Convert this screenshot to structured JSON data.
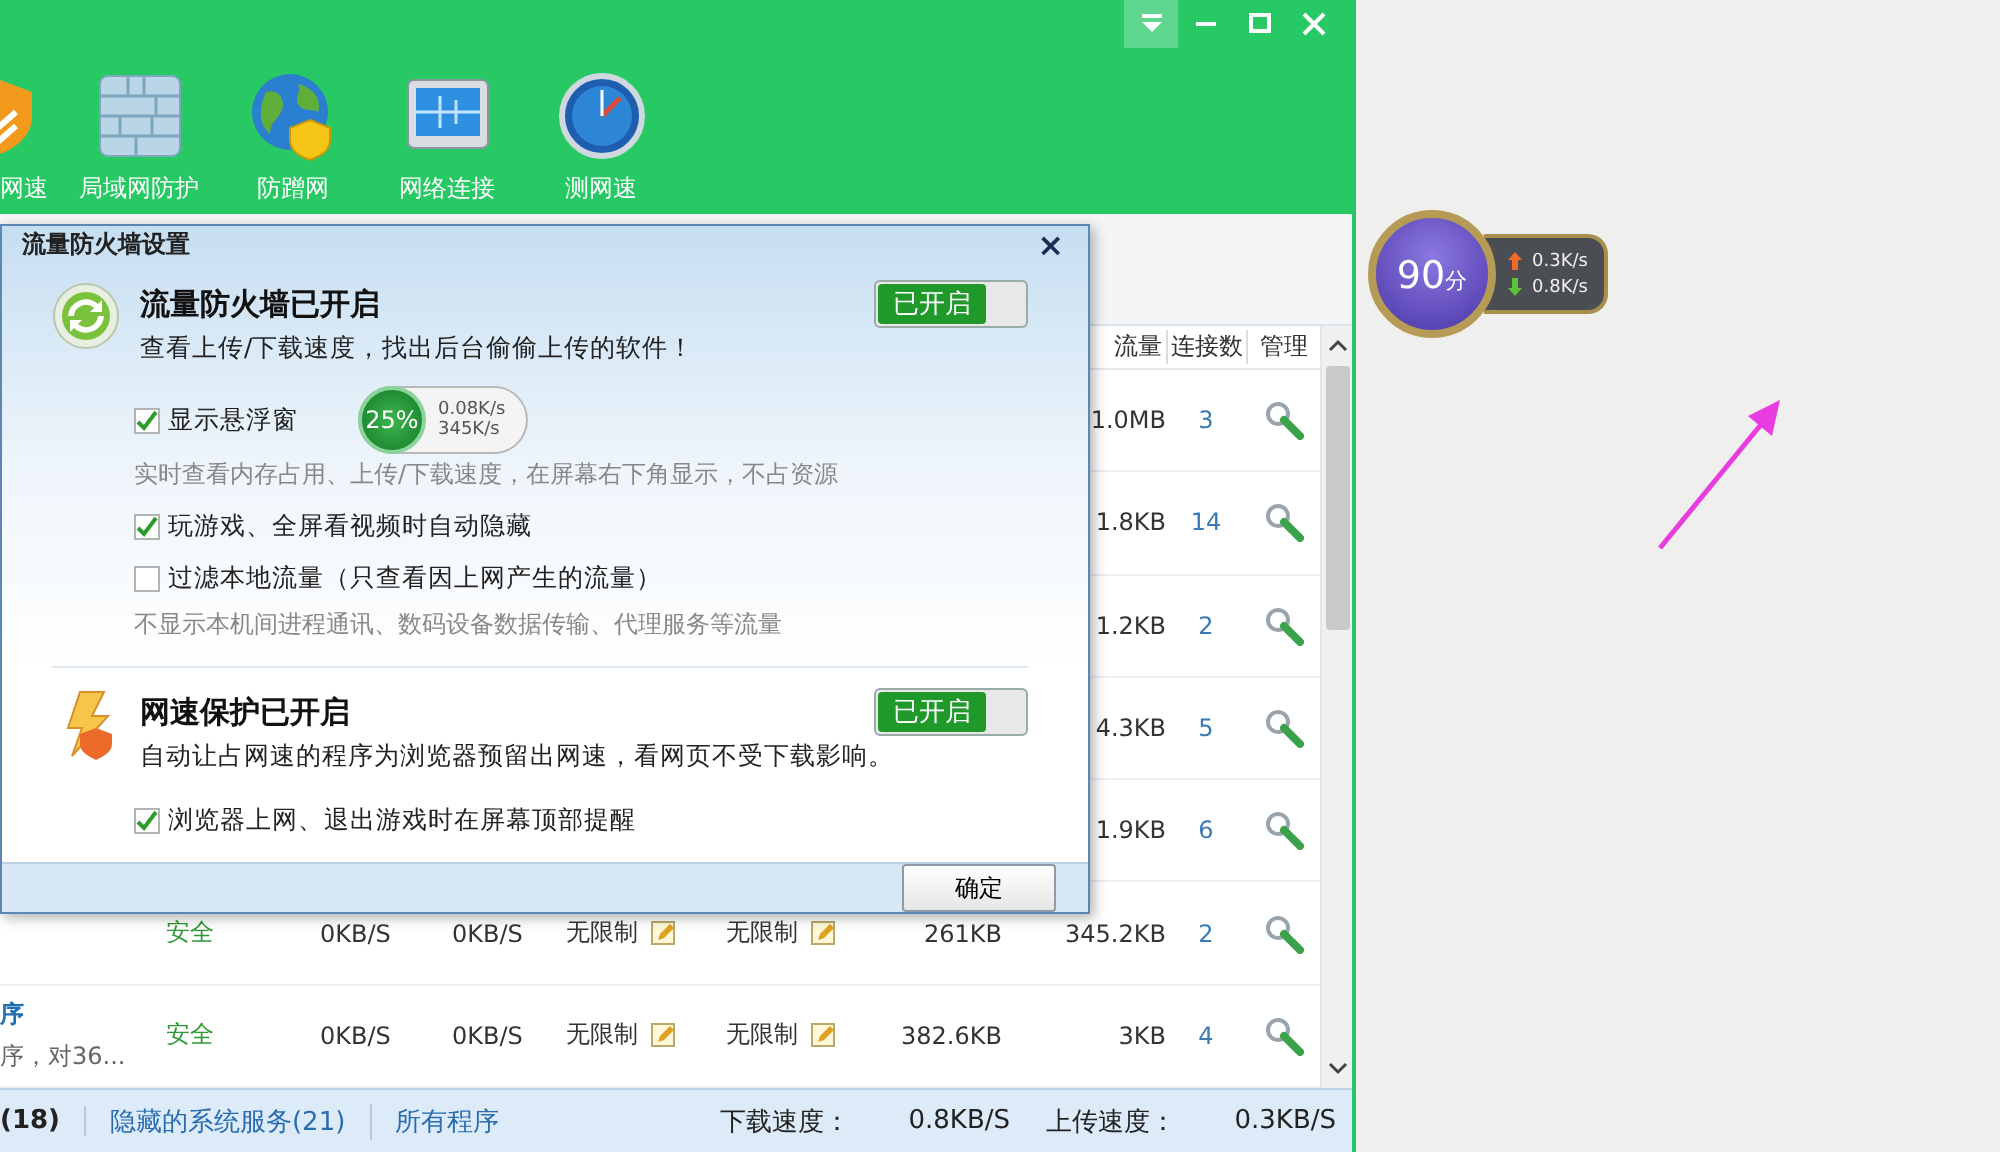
{
  "app": {
    "window_controls": [
      {
        "kind": "dropdown",
        "highlighted": true
      },
      {
        "kind": "minimize",
        "highlighted": false
      },
      {
        "kind": "maximize",
        "highlighted": false
      },
      {
        "kind": "close",
        "highlighted": false
      }
    ],
    "toolbar": [
      {
        "label": "网速",
        "kind": "shield"
      },
      {
        "label": "局域网防护",
        "kind": "wall"
      },
      {
        "label": "防蹭网",
        "kind": "globe"
      },
      {
        "label": "网络连接",
        "kind": "monitor"
      },
      {
        "label": "测网速",
        "kind": "gauge"
      }
    ],
    "table": {
      "columns": [
        {
          "label": "流量"
        },
        {
          "label": "连接数"
        },
        {
          "label": "管理"
        }
      ],
      "rows": [
        {
          "uploaded": "1.0MB",
          "connections": "3"
        },
        {
          "uploaded": "1.8KB",
          "connections": "14"
        },
        {
          "uploaded": "1.2KB",
          "connections": "2"
        },
        {
          "uploaded": "4.3KB",
          "connections": "5"
        },
        {
          "uploaded": "1.9KB",
          "connections": "6"
        },
        {
          "status": "安全",
          "down_speed": "0KB/S",
          "up_speed": "0KB/S",
          "down_limit": "无限制",
          "up_limit": "无限制",
          "downloaded": "261KB",
          "uploaded": "345.2KB",
          "connections": "2"
        },
        {
          "name": "序",
          "detail": "序，对36...",
          "status": "安全",
          "down_speed": "0KB/S",
          "up_speed": "0KB/S",
          "down_limit": "无限制",
          "up_limit": "无限制",
          "downloaded": "382.6KB",
          "uploaded": "3KB",
          "connections": "4"
        }
      ]
    },
    "status_bar": {
      "links": [
        {
          "text": "(18)",
          "kind": "count"
        },
        {
          "text": "隐藏的系统服务(21)",
          "kind": "link"
        },
        {
          "text": "所有程序",
          "kind": "link"
        }
      ],
      "speeds": [
        {
          "label": "下载速度：",
          "value": "0.8KB/S"
        },
        {
          "label": "上传速度：",
          "value": "0.3KB/S"
        }
      ]
    }
  },
  "dialog": {
    "title": "流量防火墙设置",
    "close": "×",
    "sections": [
      {
        "kind": "firewall",
        "title": "流量防火墙已开启",
        "description": "查看上传/下载速度，找出后台偷偷上传的软件！",
        "toggle": {
          "label": "已开启",
          "on": true
        },
        "options": [
          {
            "label": "显示悬浮窗",
            "checked": true,
            "preview": {
              "percent": "25%",
              "up": "0.08K/s",
              "down": "345K/s"
            },
            "hint": "实时查看内存占用、上传/下载速度，在屏幕右下角显示，不占资源"
          },
          {
            "label": "玩游戏、全屏看视频时自动隐藏",
            "checked": true
          },
          {
            "label": "过滤本地流量（只查看因上网产生的流量）",
            "checked": false,
            "hint": "不显示本机间进程通讯、数码设备数据传输、代理服务等流量"
          }
        ]
      },
      {
        "kind": "speed",
        "title": "网速保护已开启",
        "description": "自动让占网速的程序为浏览器预留出网速，看网页不受下载影响。",
        "toggle": {
          "label": "已开启",
          "on": true
        },
        "options": [
          {
            "label": "浏览器上网、退出游戏时在屏幕顶部提醒",
            "checked": true
          }
        ]
      }
    ],
    "button": "确定"
  },
  "float_widget": {
    "score": "90",
    "unit": "分",
    "up": "0.3K/s",
    "down": "0.8K/s"
  }
}
